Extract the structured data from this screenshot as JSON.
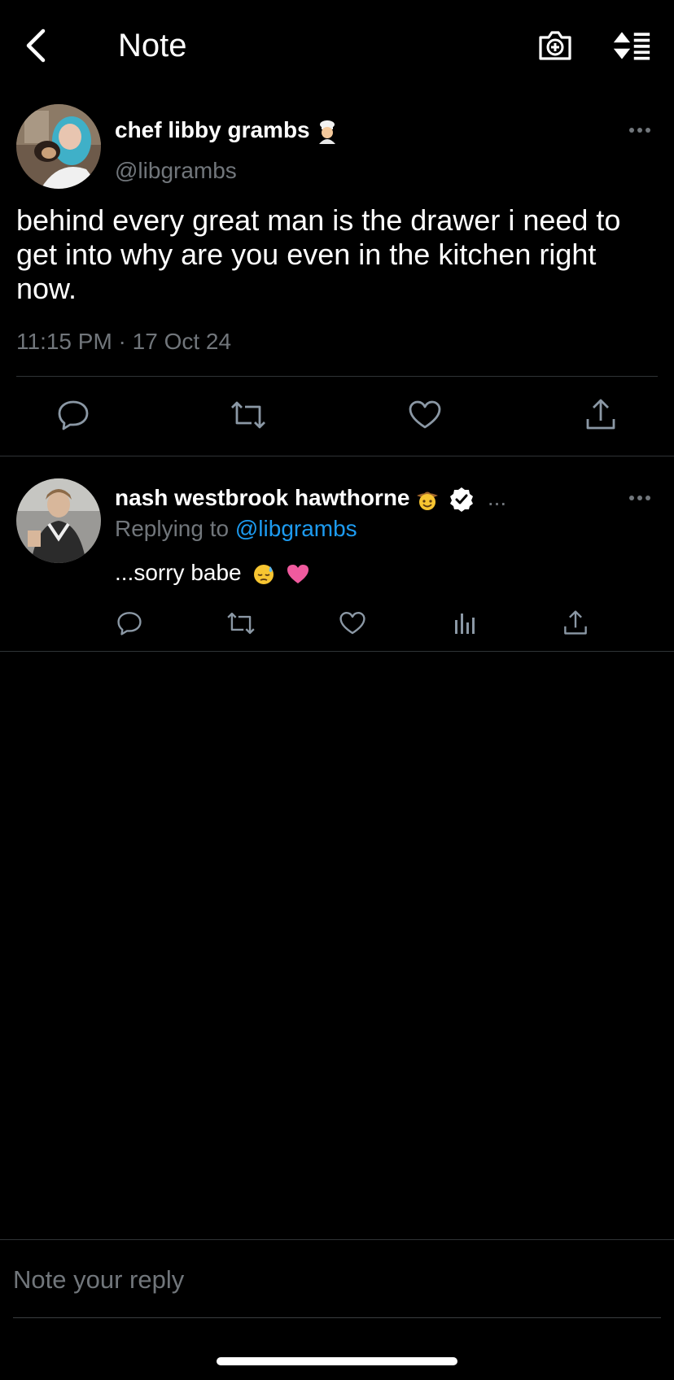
{
  "header": {
    "title": "Note"
  },
  "main_tweet": {
    "author_name": "chef libby grambs",
    "author_handle": "@libgrambs",
    "text": "behind every great man is the drawer i need to get into why are you even in the kitchen right now.",
    "timestamp": "11:15 PM · 17 Oct 24"
  },
  "reply": {
    "author_name": "nash westbrook hawthorne",
    "name_overflow": "...",
    "replying_prefix": "Replying to",
    "replying_handle": "@libgrambs",
    "text": "...sorry babe"
  },
  "composer": {
    "placeholder": "Note your reply"
  },
  "colors": {
    "background": "#000000",
    "muted": "#71767b",
    "link": "#1d9bf0",
    "divider": "#2f3336",
    "icon": "#8b98a5"
  },
  "icons": {
    "back": "chevron-left-icon",
    "camera": "camera-plus-icon",
    "sort": "sort-lines-icon",
    "more": "ellipsis-icon",
    "reply": "reply-bubble-icon",
    "retweet": "retweet-icon",
    "like": "heart-icon",
    "share": "share-icon",
    "analytics": "analytics-icon",
    "verified": "verified-badge-icon"
  }
}
